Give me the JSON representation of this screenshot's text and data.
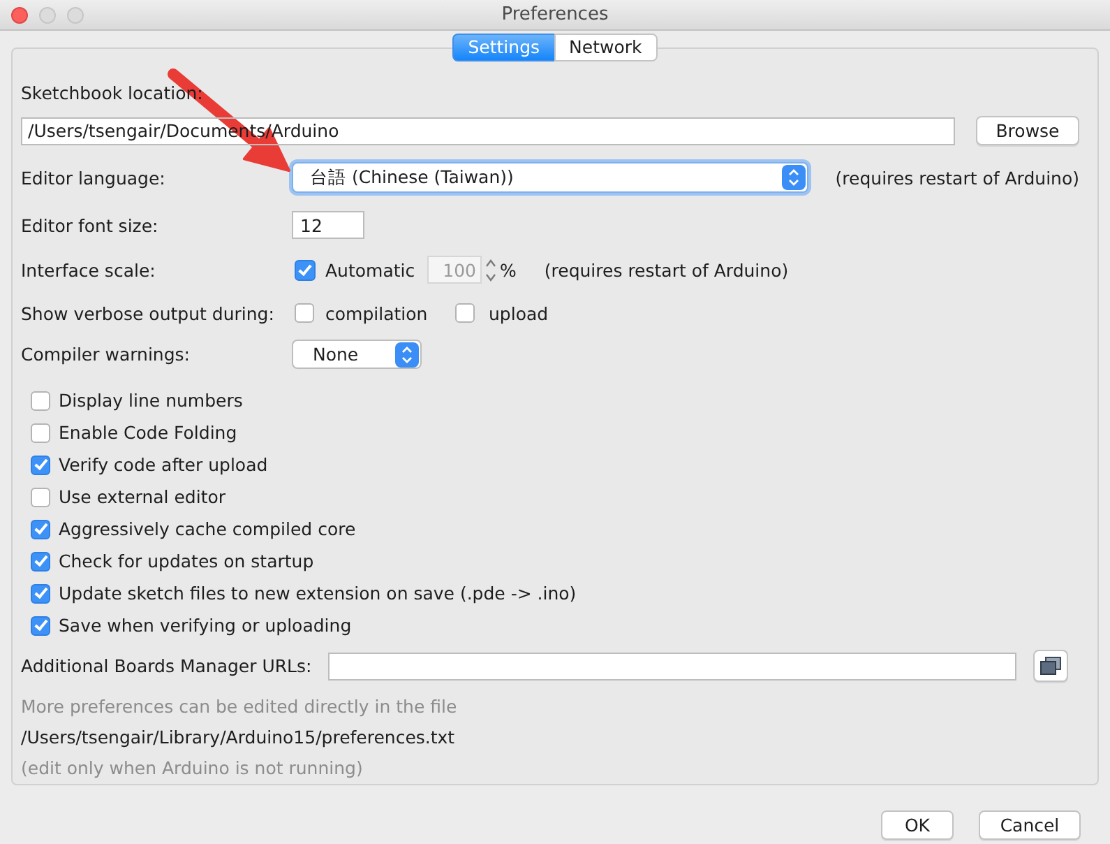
{
  "window": {
    "title": "Preferences",
    "tabs": [
      {
        "label": "Settings",
        "selected": true
      },
      {
        "label": "Network",
        "selected": false
      }
    ]
  },
  "settings": {
    "sketchbook_location": {
      "label": "Sketchbook location:",
      "value": "/Users/tsengair/Documents/Arduino",
      "button": "Browse"
    },
    "editor_language": {
      "label": "Editor language:",
      "value": "台語 (Chinese (Taiwan))",
      "focused": true,
      "note": "(requires restart of Arduino)"
    },
    "editor_font_size": {
      "label": "Editor font size:",
      "value": "12"
    },
    "interface_scale": {
      "label": "Interface scale:",
      "automatic": {
        "label": "Automatic",
        "checked": true
      },
      "value": "100",
      "disabled": true,
      "unit": "%",
      "note": "(requires restart of Arduino)"
    },
    "verbose_output": {
      "label": "Show verbose output during:",
      "options": [
        {
          "label": "compilation",
          "checked": false
        },
        {
          "label": "upload",
          "checked": false
        }
      ]
    },
    "compiler_warnings": {
      "label": "Compiler warnings:",
      "value": "None"
    },
    "options": [
      {
        "label": "Display line numbers",
        "checked": false
      },
      {
        "label": "Enable Code Folding",
        "checked": false
      },
      {
        "label": "Verify code after upload",
        "checked": true
      },
      {
        "label": "Use external editor",
        "checked": false
      },
      {
        "label": "Aggressively cache compiled core",
        "checked": true
      },
      {
        "label": "Check for updates on startup",
        "checked": true
      },
      {
        "label": "Update sketch files to new extension on save (.pde -> .ino)",
        "checked": true
      },
      {
        "label": "Save when verifying or uploading",
        "checked": true
      }
    ],
    "boards_manager_urls": {
      "label": "Additional Boards Manager URLs:"
    },
    "file_info": {
      "intro": "More preferences can be edited directly in the file",
      "path": "/Users/tsengair/Library/Arduino15/preferences.txt",
      "hint": "(edit only when Arduino is not running)"
    }
  },
  "buttons": [
    "OK",
    "Cancel"
  ]
}
